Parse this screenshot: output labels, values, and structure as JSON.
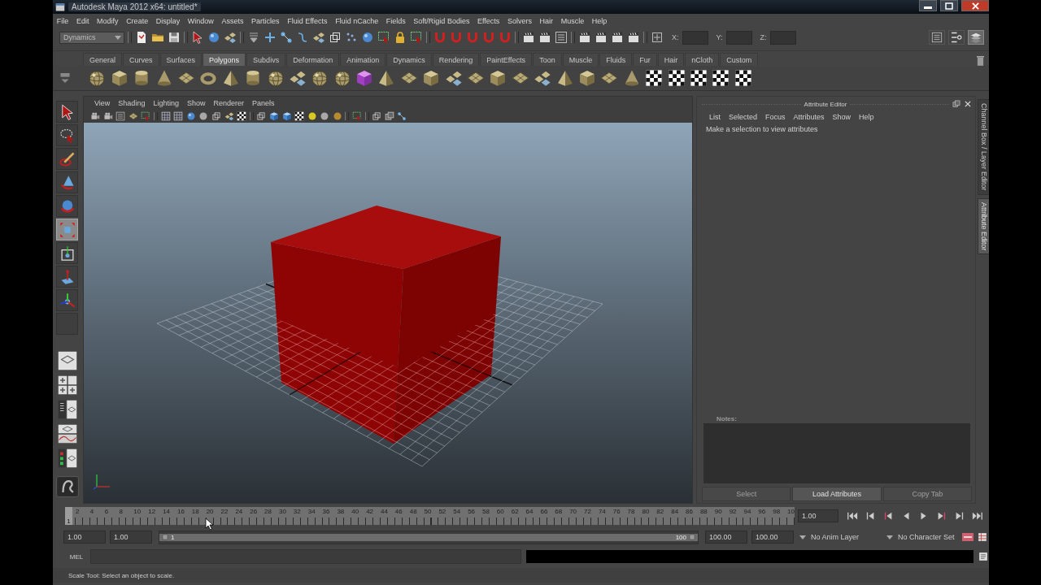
{
  "window": {
    "title": "Autodesk Maya 2012 x64: untitled*"
  },
  "menu_bar": [
    "File",
    "Edit",
    "Modify",
    "Create",
    "Display",
    "Window",
    "Assets",
    "Particles",
    "Fluid Effects",
    "Fluid nCache",
    "Fields",
    "Soft/Rigid Bodies",
    "Effects",
    "Solvers",
    "Hair",
    "Muscle",
    "Help"
  ],
  "status_line": {
    "menu_set": "Dynamics",
    "x_label": "X:",
    "y_label": "Y:",
    "z_label": "Z:",
    "panel_toggles": [
      {
        "on": false
      },
      {
        "on": false
      },
      {
        "on": true
      }
    ]
  },
  "shelf": {
    "tabs": [
      {
        "label": "General",
        "selected": false
      },
      {
        "label": "Curves",
        "selected": false
      },
      {
        "label": "Surfaces",
        "selected": false
      },
      {
        "label": "Polygons",
        "selected": true
      },
      {
        "label": "Subdivs",
        "selected": false
      },
      {
        "label": "Deformation",
        "selected": false
      },
      {
        "label": "Animation",
        "selected": false
      },
      {
        "label": "Dynamics",
        "selected": false
      },
      {
        "label": "Rendering",
        "selected": false
      },
      {
        "label": "PaintEffects",
        "selected": false
      },
      {
        "label": "Toon",
        "selected": false
      },
      {
        "label": "Muscle",
        "selected": false
      },
      {
        "label": "Fluids",
        "selected": false
      },
      {
        "label": "Fur",
        "selected": false
      },
      {
        "label": "Hair",
        "selected": false
      },
      {
        "label": "nCloth",
        "selected": false
      },
      {
        "label": "Custom",
        "selected": false
      }
    ]
  },
  "toolbox": {
    "tools": [
      {
        "selected": false
      },
      {
        "selected": false
      },
      {
        "selected": false
      },
      {
        "selected": false
      },
      {
        "selected": false
      },
      {
        "selected": true
      },
      {
        "selected": false
      },
      {
        "selected": false
      },
      {
        "selected": false
      },
      {
        "selected": false
      }
    ]
  },
  "viewport": {
    "menu": [
      "View",
      "Shading",
      "Lighting",
      "Show",
      "Renderer",
      "Panels"
    ]
  },
  "attribute_editor": {
    "title": "Attribute Editor",
    "menu": [
      "List",
      "Selected",
      "Focus",
      "Attributes",
      "Show",
      "Help"
    ],
    "message": "Make a selection to view attributes",
    "notes_label": "Notes:",
    "buttons": [
      {
        "label": "Select",
        "disabled": true
      },
      {
        "label": "Load Attributes",
        "disabled": false
      },
      {
        "label": "Copy Tab",
        "disabled": true
      }
    ]
  },
  "side_tabs": [
    {
      "label": "Channel Box / Layer Editor",
      "selected": false
    },
    {
      "label": "Attribute Editor",
      "selected": true
    }
  ],
  "time_slider": {
    "frame_numbers": [
      "2",
      "4",
      "6",
      "8",
      "10",
      "12",
      "14",
      "16",
      "18",
      "20",
      "22",
      "24",
      "26",
      "28",
      "30",
      "32",
      "34",
      "36",
      "38",
      "40",
      "42",
      "44",
      "46",
      "48",
      "50",
      "52",
      "54",
      "56",
      "58",
      "60",
      "62",
      "64",
      "66",
      "68",
      "70",
      "72",
      "74",
      "76",
      "78",
      "80",
      "82",
      "84",
      "86",
      "88",
      "90",
      "92",
      "94",
      "96",
      "98",
      "10"
    ],
    "level": 0,
    "current_frame": "1",
    "current_time": "1.00"
  },
  "range_slider": {
    "start_time": "1.00",
    "playback_start": "1.00",
    "level": 1,
    "range_start": "1",
    "range_end": "100",
    "playback_end": "100.00",
    "end_time": "100.00",
    "anim_layer": "No Anim Layer",
    "character_set": "No Character Set"
  },
  "command_line": {
    "language": "MEL"
  },
  "help_line": "Scale Tool: Select an object to scale."
}
